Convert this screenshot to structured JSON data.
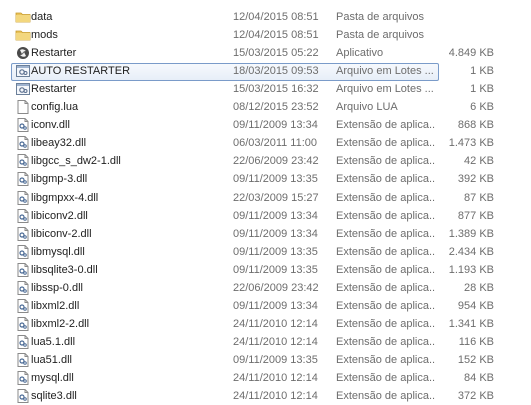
{
  "files": [
    {
      "name": "data",
      "date": "12/04/2015 08:51",
      "type": "Pasta de arquivos",
      "size": "",
      "icon": "folder-icon"
    },
    {
      "name": "mods",
      "date": "12/04/2015 08:51",
      "type": "Pasta de arquivos",
      "size": "",
      "icon": "folder-icon"
    },
    {
      "name": "Restarter",
      "date": "15/03/2015 05:22",
      "type": "Aplicativo",
      "size": "4.849 KB",
      "icon": "application-icon"
    },
    {
      "name": "AUTO RESTARTER",
      "date": "18/03/2015 09:53",
      "type": "Arquivo em Lotes ...",
      "size": "1 KB",
      "icon": "batch-file-icon",
      "selected": true
    },
    {
      "name": "Restarter",
      "date": "15/03/2015 16:32",
      "type": "Arquivo em Lotes ...",
      "size": "1 KB",
      "icon": "batch-file-icon"
    },
    {
      "name": "config.lua",
      "date": "08/12/2015 23:52",
      "type": "Arquivo LUA",
      "size": "6 KB",
      "icon": "text-file-icon"
    },
    {
      "name": "iconv.dll",
      "date": "09/11/2009 13:34",
      "type": "Extensão de aplica...",
      "size": "868 KB",
      "icon": "dll-file-icon"
    },
    {
      "name": "libeay32.dll",
      "date": "06/03/2011 11:00",
      "type": "Extensão de aplica...",
      "size": "1.473 KB",
      "icon": "dll-file-icon"
    },
    {
      "name": "libgcc_s_dw2-1.dll",
      "date": "22/06/2009 23:42",
      "type": "Extensão de aplica...",
      "size": "42 KB",
      "icon": "dll-file-icon"
    },
    {
      "name": "libgmp-3.dll",
      "date": "09/11/2009 13:35",
      "type": "Extensão de aplica...",
      "size": "392 KB",
      "icon": "dll-file-icon"
    },
    {
      "name": "libgmpxx-4.dll",
      "date": "22/03/2009 15:27",
      "type": "Extensão de aplica...",
      "size": "87 KB",
      "icon": "dll-file-icon"
    },
    {
      "name": "libiconv2.dll",
      "date": "09/11/2009 13:34",
      "type": "Extensão de aplica...",
      "size": "877 KB",
      "icon": "dll-file-icon"
    },
    {
      "name": "libiconv-2.dll",
      "date": "09/11/2009 13:34",
      "type": "Extensão de aplica...",
      "size": "1.389 KB",
      "icon": "dll-file-icon"
    },
    {
      "name": "libmysql.dll",
      "date": "09/11/2009 13:35",
      "type": "Extensão de aplica...",
      "size": "2.434 KB",
      "icon": "dll-file-icon"
    },
    {
      "name": "libsqlite3-0.dll",
      "date": "09/11/2009 13:35",
      "type": "Extensão de aplica...",
      "size": "1.193 KB",
      "icon": "dll-file-icon"
    },
    {
      "name": "libssp-0.dll",
      "date": "22/06/2009 23:42",
      "type": "Extensão de aplica...",
      "size": "28 KB",
      "icon": "dll-file-icon"
    },
    {
      "name": "libxml2.dll",
      "date": "09/11/2009 13:34",
      "type": "Extensão de aplica...",
      "size": "954 KB",
      "icon": "dll-file-icon"
    },
    {
      "name": "libxml2-2.dll",
      "date": "24/11/2010 12:14",
      "type": "Extensão de aplica...",
      "size": "1.341 KB",
      "icon": "dll-file-icon"
    },
    {
      "name": "lua5.1.dll",
      "date": "24/11/2010 12:14",
      "type": "Extensão de aplica...",
      "size": "116 KB",
      "icon": "dll-file-icon"
    },
    {
      "name": "lua51.dll",
      "date": "09/11/2009 13:35",
      "type": "Extensão de aplica...",
      "size": "152 KB",
      "icon": "dll-file-icon"
    },
    {
      "name": "mysql.dll",
      "date": "24/11/2010 12:14",
      "type": "Extensão de aplica...",
      "size": "84 KB",
      "icon": "dll-file-icon"
    },
    {
      "name": "sqlite3.dll",
      "date": "24/11/2010 12:14",
      "type": "Extensão de aplica...",
      "size": "372 KB",
      "icon": "dll-file-icon"
    }
  ],
  "colors": {
    "selection_border": "#7a9bc9",
    "meta_text": "#6d6d6d",
    "folder": "#e8c25a"
  }
}
